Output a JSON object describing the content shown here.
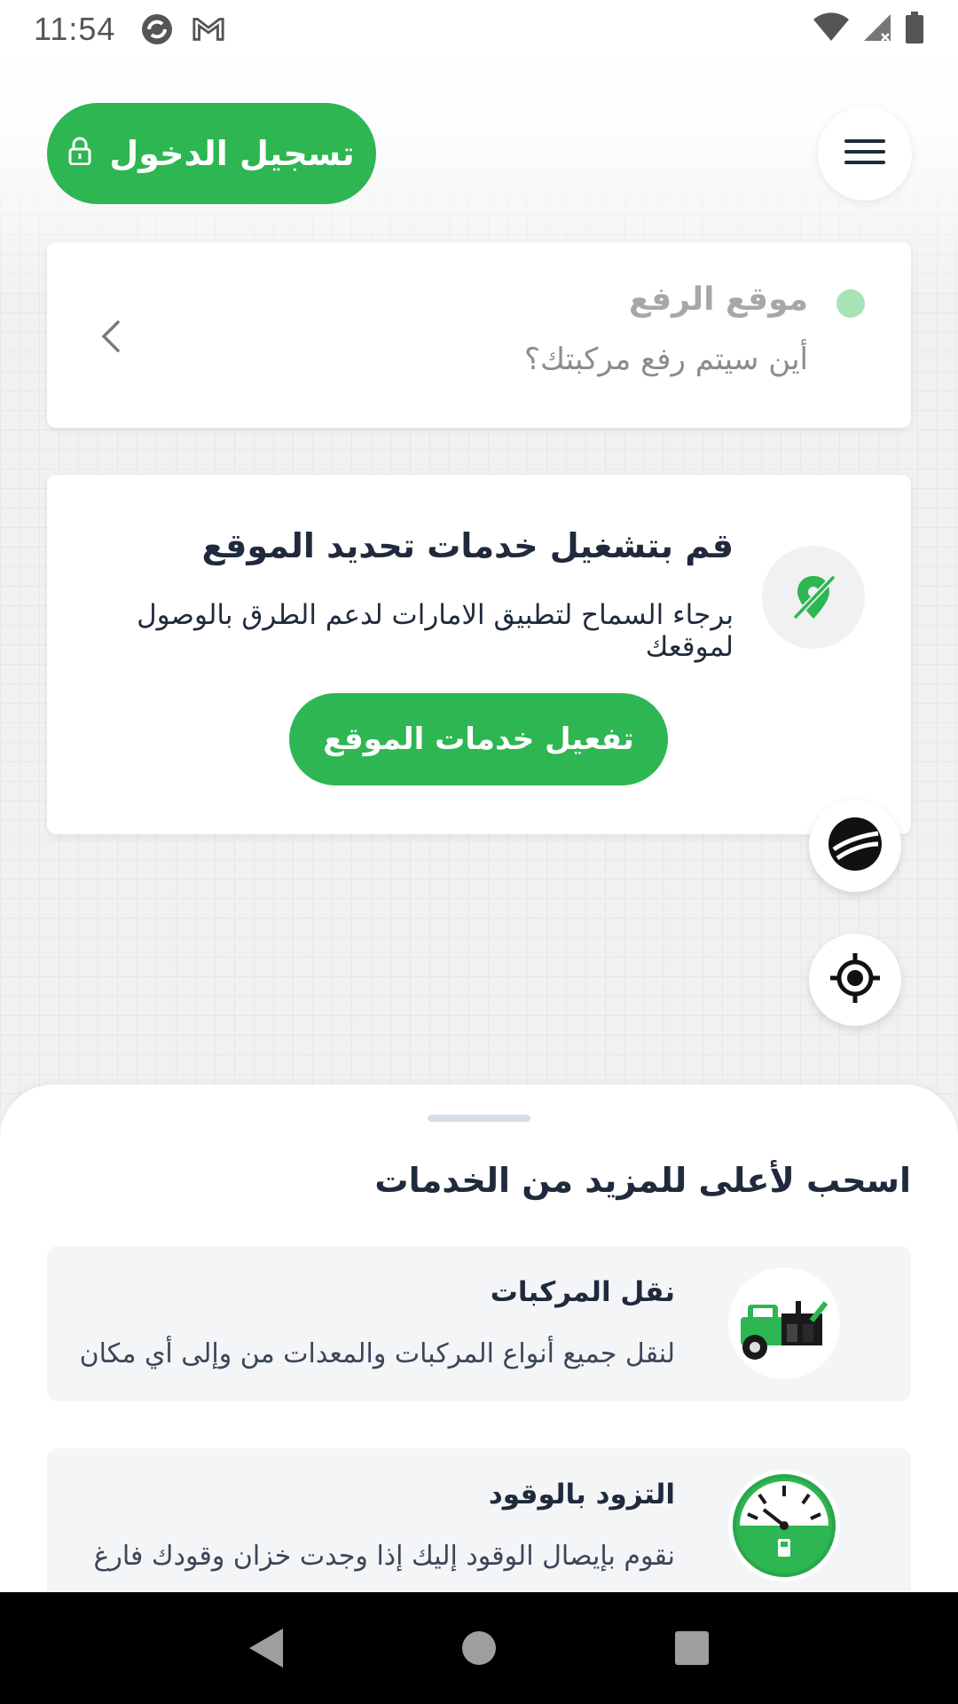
{
  "status_bar": {
    "time": "11:54",
    "icons": [
      "sync-app-icon",
      "gmail-icon",
      "wifi-icon",
      "signal-icon",
      "battery-icon"
    ]
  },
  "header": {
    "login_label": "تسجيل الدخول",
    "login_icon": "lock-icon",
    "menu_icon": "hamburger-menu-icon"
  },
  "pickup": {
    "title": "موقع الرفع",
    "subtitle": "أين سيتم رفع مركبتك؟"
  },
  "permission": {
    "title": "قم بتشغيل خدمات تحديد الموقع",
    "description": "برجاء السماح لتطبيق الامارات لدعم الطرق بالوصول لموقعك",
    "button_label": "تفعيل خدمات الموقع",
    "icon": "location-off-icon"
  },
  "map_controls": {
    "globe_icon": "globe-icon",
    "locate_icon": "my-location-icon"
  },
  "sheet": {
    "title": "اسحب لأعلى للمزيد من الخدمات",
    "services": [
      {
        "title": "نقل المركبات",
        "description": "لنقل جميع أنواع المركبات والمعدات من وإلى أي مكان",
        "icon": "tow-truck-icon"
      },
      {
        "title": "التزود بالوقود",
        "description": "نقوم بإيصال الوقود إليك إذا وجدت خزان وقودك فارغ",
        "icon": "fuel-gauge-icon"
      }
    ]
  },
  "colors": {
    "primary": "#2db652",
    "text_dark": "#1f2a3c",
    "muted": "#a7a7a7"
  },
  "nav": {
    "back_icon": "back-triangle-icon",
    "home_icon": "home-circle-icon",
    "recents_icon": "recents-square-icon"
  }
}
